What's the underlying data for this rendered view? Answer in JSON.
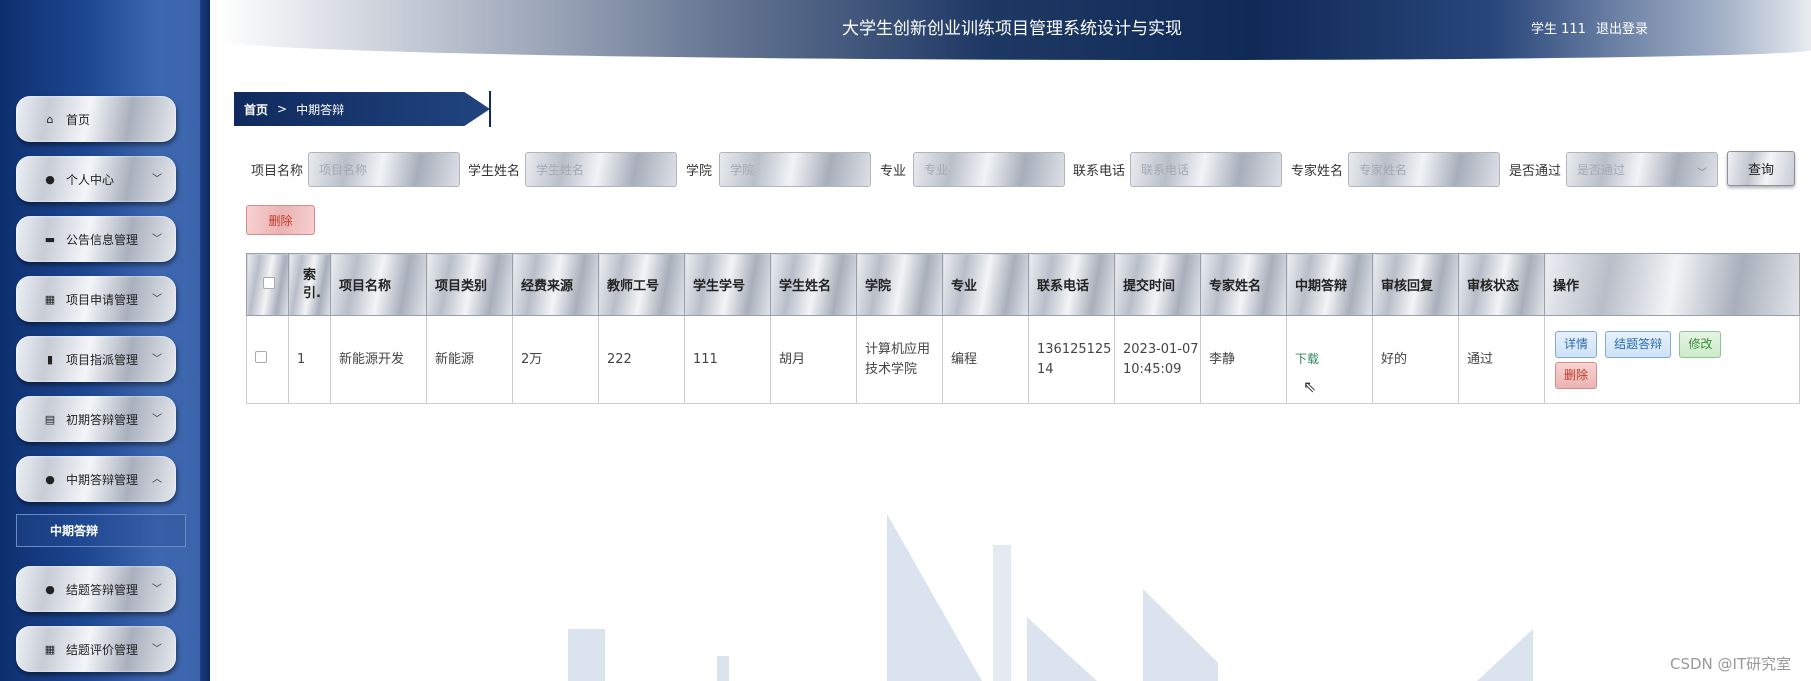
{
  "header": {
    "title": "大学生创新创业训练项目管理系统设计与实现",
    "user": "学生 111",
    "logout": "退出登录"
  },
  "sidebar": {
    "items": [
      {
        "label": "首页",
        "icon": "home-icon",
        "glyph": "⌂",
        "has_chevron": false
      },
      {
        "label": "个人中心",
        "icon": "user-icon",
        "glyph": "●",
        "has_chevron": true
      },
      {
        "label": "公告信息管理",
        "icon": "briefcase-icon",
        "glyph": "▬",
        "has_chevron": true
      },
      {
        "label": "项目申请管理",
        "icon": "grid-icon",
        "glyph": "▦",
        "has_chevron": true
      },
      {
        "label": "项目指派管理",
        "icon": "bar-chart-icon",
        "glyph": "▮",
        "has_chevron": true
      },
      {
        "label": "初期答辩管理",
        "icon": "clipboard-icon",
        "glyph": "▤",
        "has_chevron": true
      },
      {
        "label": "中期答辩管理",
        "icon": "lightbulb-icon",
        "glyph": "●",
        "has_chevron": true,
        "expanded": true
      },
      {
        "label": "结题答辩管理",
        "icon": "user-icon",
        "glyph": "●",
        "has_chevron": true
      },
      {
        "label": "结题评价管理",
        "icon": "grid-icon",
        "glyph": "▦",
        "has_chevron": true
      }
    ],
    "sub_item": "中期答辩"
  },
  "breadcrumb": {
    "home": "首页",
    "separator": ">",
    "current": "中期答辩"
  },
  "search": {
    "fields": [
      {
        "label": "项目名称",
        "placeholder": "项目名称"
      },
      {
        "label": "学生姓名",
        "placeholder": "学生姓名"
      },
      {
        "label": "学院",
        "placeholder": "学院"
      },
      {
        "label": "专业",
        "placeholder": "专业"
      },
      {
        "label": "联系电话",
        "placeholder": "联系电话"
      },
      {
        "label": "专家姓名",
        "placeholder": "专家姓名"
      },
      {
        "label": "是否通过",
        "placeholder": "是否通过"
      }
    ],
    "query_button": "查询",
    "delete_button": "删除"
  },
  "table": {
    "headers": [
      "索引.",
      "项目名称",
      "项目类别",
      "经费来源",
      "教师工号",
      "学生学号",
      "学生姓名",
      "学院",
      "专业",
      "联系电话",
      "提交时间",
      "专家姓名",
      "中期答辩",
      "审核回复",
      "审核状态",
      "操作"
    ],
    "index_header_line1": "索",
    "index_header_line2": "引.",
    "rows": [
      {
        "index": "1",
        "project_name": "新能源开发",
        "category": "新能源",
        "funding": "2万",
        "teacher_id": "222",
        "student_id": "111",
        "student_name": "胡月",
        "college": "计算机应用技术学院",
        "major": "编程",
        "phone": "13612512514",
        "submit_time": "2023-01-07 10:45:09",
        "expert": "李静",
        "midterm": "下载",
        "review_reply": "好的",
        "review_status": "通过",
        "actions": {
          "detail": "详情",
          "final": "结题答辩",
          "edit": "修改",
          "delete": "删除"
        }
      }
    ]
  },
  "watermark": "CSDN @IT研究室"
}
